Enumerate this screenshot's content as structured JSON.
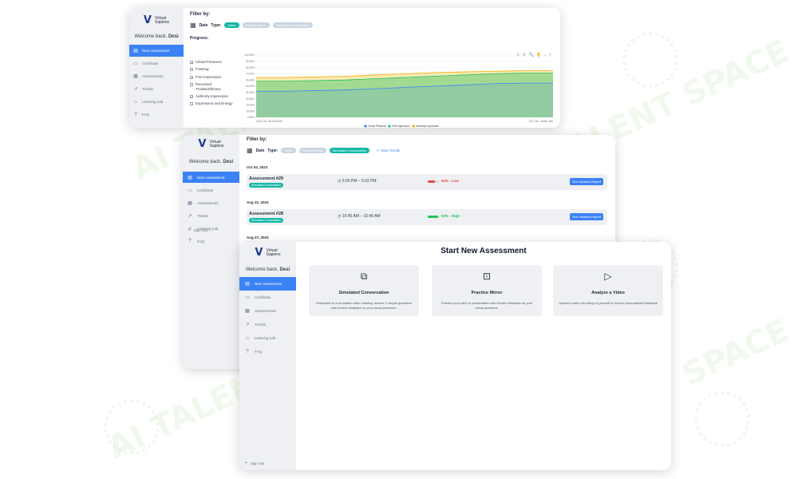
{
  "brand": {
    "logo_line1": "Virtual",
    "logo_line2": "Sapiens"
  },
  "sidebar": {
    "welcome_prefix": "Welcome back,",
    "user_name": "Desi",
    "items": [
      {
        "label": "New Assessment",
        "icon": "new-assessment-icon"
      },
      {
        "label": "Certificate",
        "icon": "certificate-icon"
      },
      {
        "label": "Assessments",
        "icon": "assessments-icon"
      },
      {
        "label": "Trends",
        "icon": "trends-icon"
      },
      {
        "label": "Learning Lab",
        "icon": "learning-lab-icon"
      },
      {
        "label": "FAQ",
        "icon": "faq-icon"
      }
    ],
    "sign_out": "Sign Out"
  },
  "trends_view": {
    "filter_title": "Filter by:",
    "date_label": "Date",
    "type_label": "Type:",
    "type_chips": [
      {
        "label": "Video",
        "active": true
      },
      {
        "label": "Practice Mirror",
        "active": false
      },
      {
        "label": "Simulated Conversation",
        "active": false
      }
    ],
    "progress_title": "Progress:",
    "metrics": [
      {
        "label": "Virtual Presence",
        "checked": true
      },
      {
        "label": "Framing",
        "checked": false
      },
      {
        "label": "First Impression",
        "checked": true
      },
      {
        "label": "Perceived Trustworthiness",
        "checked": false
      },
      {
        "label": "Authority Impression",
        "checked": true
      },
      {
        "label": "Expression and Energy",
        "checked": false
      }
    ],
    "chart_tools": "⊖ ⊕ 🔍 ✋ ⌂ ≡"
  },
  "chart_data": {
    "type": "area",
    "y_ticks": [
      "100.00%",
      "90.00%",
      "80.00%",
      "70.00%",
      "60.00%",
      "50.00%",
      "40.00%",
      "30.00%",
      "20.00%",
      "10.00%",
      "0.00%"
    ],
    "ylim": [
      0,
      100
    ],
    "x_start_label": "2023 Oct, 03:10:06 AM",
    "x_end_label": "Tue, Oct – Mode rank",
    "grid": true,
    "legend_position": "bottom",
    "x": [
      0,
      0.1,
      0.2,
      0.3,
      0.4,
      0.5,
      0.6,
      0.7,
      0.8,
      0.9,
      1.0
    ],
    "series": [
      {
        "name": "Virtual Presence",
        "color": "#3b82f6",
        "values": [
          42,
          42,
          43,
          44,
          46,
          48,
          50,
          52,
          54,
          55,
          55
        ]
      },
      {
        "name": "First Impression",
        "color": "#22c55e",
        "values": [
          58,
          58,
          59,
          60,
          62,
          64,
          66,
          68,
          70,
          71,
          71
        ]
      },
      {
        "name": "Authority Impression",
        "color": "#eab308",
        "values": [
          64,
          64,
          65,
          66,
          68,
          70,
          72,
          73,
          74,
          75,
          75
        ]
      }
    ]
  },
  "assessments_view": {
    "filter_title": "Filter by:",
    "date_label": "Date",
    "type_label": "Type:",
    "type_chips": [
      {
        "label": "Video",
        "active": false
      },
      {
        "label": "Practice Mirror",
        "active": false
      },
      {
        "label": "Simulated Conversation",
        "active": true
      }
    ],
    "view_trends": "View Trends",
    "groups": [
      {
        "date": "Oct 04, 2023",
        "name": "Assessment #29",
        "tag": "Simulated Conversation",
        "time": "5:00 PM – 5:03 PM",
        "score": "63% - Low",
        "score_color": "#ef4444",
        "level": 0.63,
        "button": "See Detailed Report"
      },
      {
        "date": "Aug 31, 2023",
        "name": "Assessment #28",
        "tag": "Simulated Conversation",
        "time": "10:45 AM – 10:49 AM",
        "score": "93% - High",
        "score_color": "#22c55e",
        "level": 0.93,
        "button": "See Detailed Report"
      }
    ],
    "next_date": "Aug 27, 2023"
  },
  "new_assessment_view": {
    "title": "Start New Assessment",
    "cards": [
      {
        "title": "Simulated Conversation",
        "desc": "Participate in a simulated video meeting, answer 3 simple questions and receive feedback on your virtual presence.",
        "icon": "video-call-icon"
      },
      {
        "title": "Practice Mirror",
        "desc": "Practice your pitch or presentation and receive feedback on your virtual presence.",
        "icon": "mirror-icon"
      },
      {
        "title": "Analyze a Video",
        "desc": "Upload a video recording of yourself to receive personalized feedback",
        "icon": "upload-video-icon"
      }
    ]
  }
}
